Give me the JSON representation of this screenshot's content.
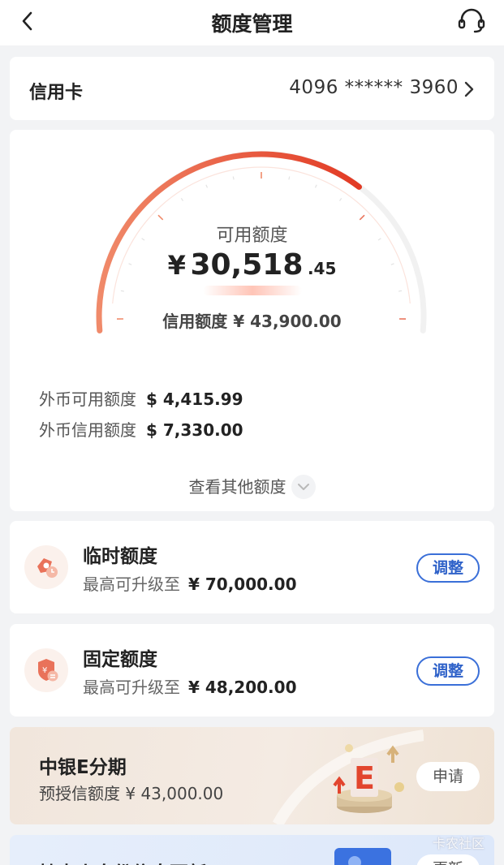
{
  "header": {
    "title": "额度管理",
    "back_icon": "chevron-left-icon",
    "service_icon": "headset-icon"
  },
  "account": {
    "label": "信用卡",
    "card_number": "4096 ****** 3960"
  },
  "overview": {
    "available_label": "可用额度",
    "available_currency": "¥",
    "available_integer": "30,518",
    "available_decimal": ".45",
    "available_fraction_of_limit": 0.695,
    "credit_limit_text": "信用额度 ¥ 43,900.00",
    "fx_available_label": "外币可用额度",
    "fx_available_value": "$ 4,415.99",
    "fx_credit_label": "外币信用额度",
    "fx_credit_value": "$ 7,330.00",
    "more_label": "查看其他额度"
  },
  "temp_limit": {
    "title": "临时额度",
    "sub_label": "最高可升级至",
    "sub_amount": "¥ 70,000.00",
    "button": "调整"
  },
  "fixed_limit": {
    "title": "固定额度",
    "sub_label": "最高可升级至",
    "sub_amount": "¥ 48,200.00",
    "button": "调整"
  },
  "promo": {
    "title": "中银E分期",
    "subtitle": "预授信额度 ¥ 43,000.00",
    "button": "申请"
  },
  "banner2": {
    "title": "持卡人身份信息更新",
    "button": "更新"
  },
  "watermark": "卡农社区",
  "colors": {
    "accent_red": "#e84a36",
    "button_blue": "#2f62c9",
    "background": "#f2f3f5"
  }
}
